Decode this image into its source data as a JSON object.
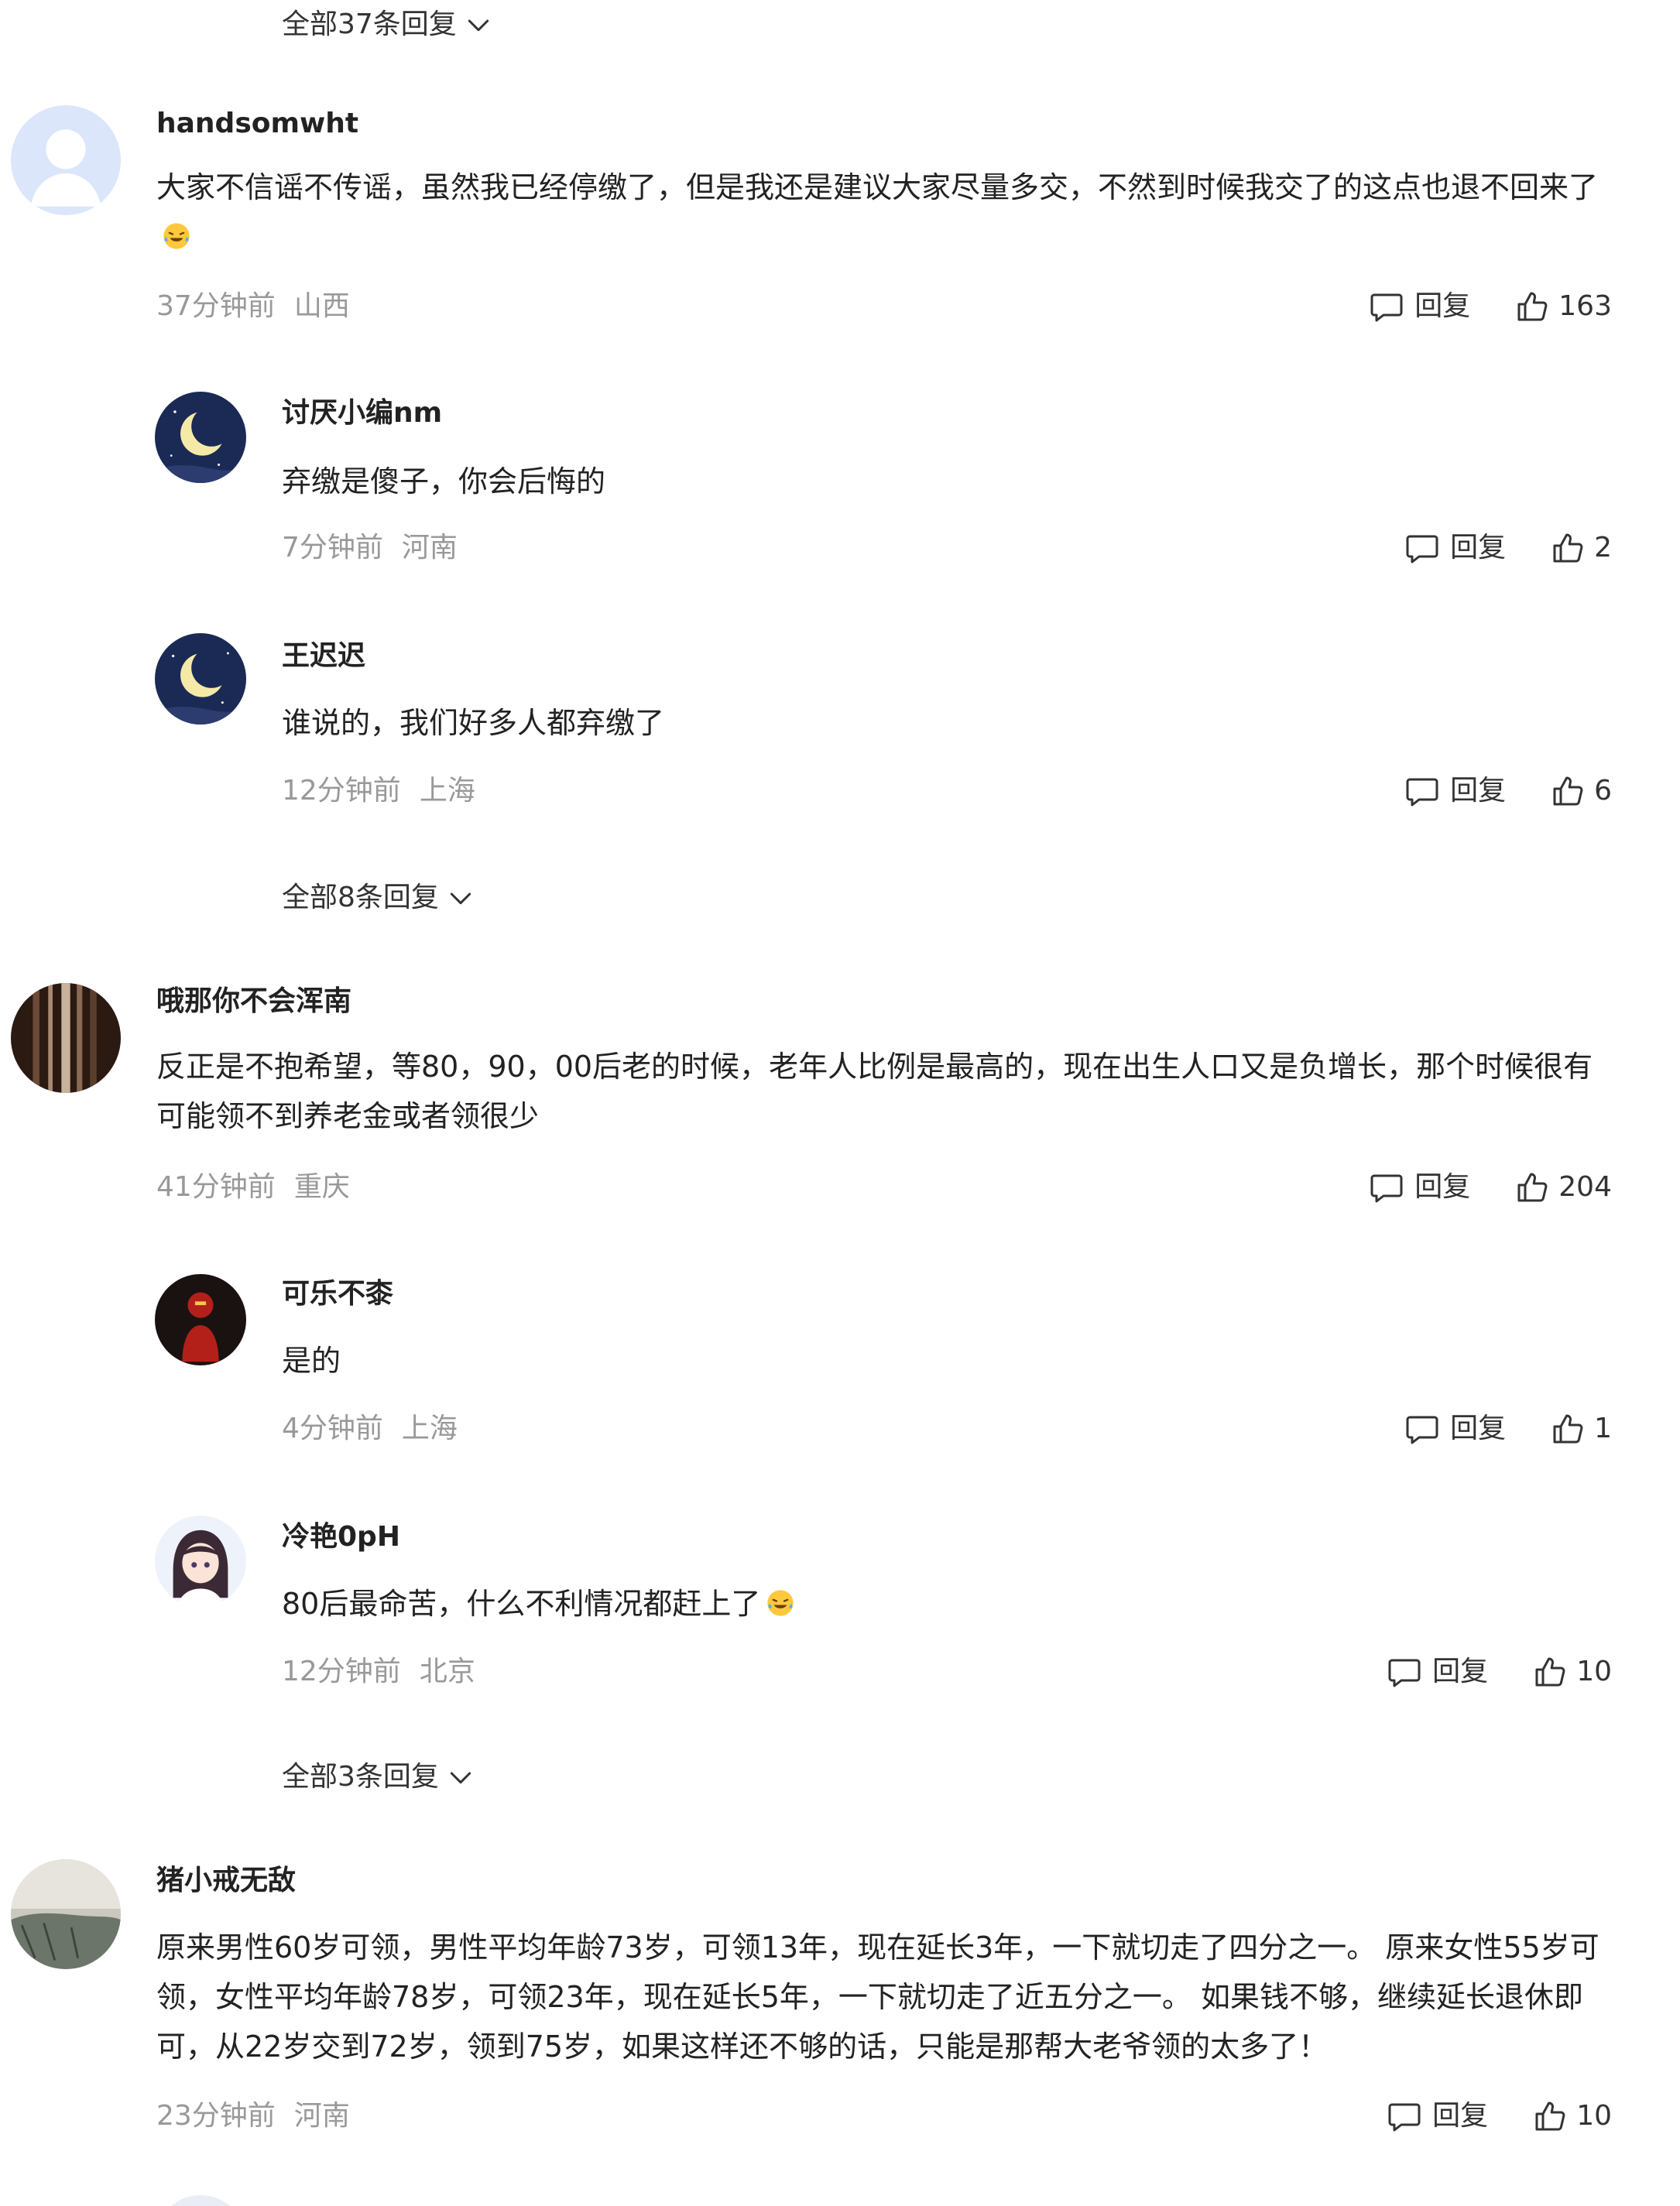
{
  "expand_labels": [
    "全部37条回复",
    "全部8条回复",
    "全部3条回复"
  ],
  "reply_label": "回复",
  "icons": {
    "reply": "comment-bubble-icon",
    "like": "thumbs-up-icon",
    "expand": "chevron-down-icon"
  },
  "comments": [
    {
      "user": "handsomwht",
      "text": "大家不信谣不传谣，虽然我已经停缴了，但是我还是建议大家尽量多交，不然到时候我交了的这点也退不回来了",
      "time": "37分钟前",
      "location": "山西",
      "likes": "163",
      "replies": [
        {
          "user": "讨厌小编nm",
          "text": "弃缴是傻子，你会后悔的",
          "time": "7分钟前",
          "location": "河南",
          "likes": "2"
        },
        {
          "user": "王迟迟",
          "text": "谁说的，我们好多人都弃缴了",
          "time": "12分钟前",
          "location": "上海",
          "likes": "6"
        }
      ]
    },
    {
      "user": "哦那你不会浑南",
      "text": "反正是不抱希望，等80，90，00后老的时候，老年人比例是最高的，现在出生人口又是负增长，那个时候很有可能领不到养老金或者领很少",
      "time": "41分钟前",
      "location": "重庆",
      "likes": "204",
      "replies": [
        {
          "user": "可乐不桼",
          "text": "是的",
          "time": "4分钟前",
          "location": "上海",
          "likes": "1"
        },
        {
          "user": "冷艳0pH",
          "text": "80后最命苦，什么不利情况都赶上了",
          "time": "12分钟前",
          "location": "北京",
          "likes": "10"
        }
      ]
    },
    {
      "user": "猪小戒无敌",
      "text": "原来男性60岁可领，男性平均年龄73岁，可领13年，现在延长3年，一下就切走了四分之一。 原来女性55岁可领，女性平均年龄78岁，可领23年，现在延长5年，一下就切走了近五分之一。 如果钱不够，继续延长退休即可，从22岁交到72岁，领到75岁，如果这样还不够的话，只能是那帮大老爷领的太多了！",
      "time": "23分钟前",
      "location": "河南",
      "likes": "10",
      "replies": []
    }
  ]
}
